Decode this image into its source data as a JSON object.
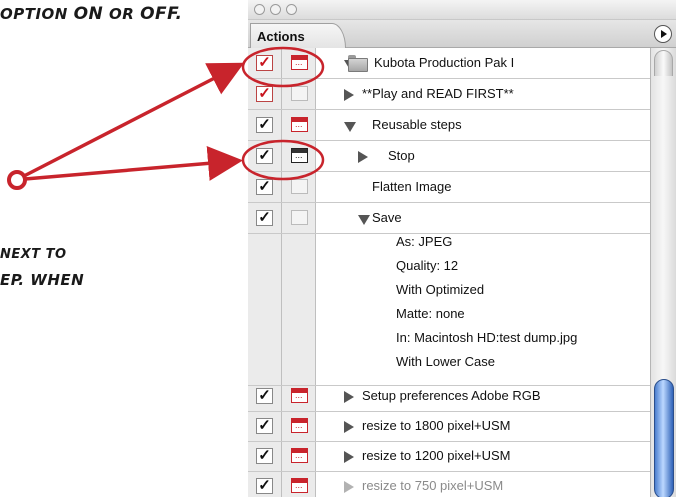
{
  "annotation": {
    "top_text_start": "OPTION",
    "top_on": "ON",
    "top_or": "OR",
    "top_off": "OFF.",
    "side_line1": "NEXT TO",
    "side_line2": "EP. WHEN"
  },
  "colors": {
    "annotation_red": "#c8242c",
    "scroll_thumb": "#4c7fcf"
  },
  "panel": {
    "tab_label": "Actions",
    "menu_icon": "panel-menu-icon"
  },
  "rows": [
    {
      "label": "Kubota Production Pak I",
      "toggle": "red",
      "dialog": "red",
      "expand": "down",
      "indent": 0,
      "folder": true
    },
    {
      "label": "**Play and READ FIRST**",
      "toggle": "red",
      "dialog": "empty",
      "expand": "right",
      "indent": 1
    },
    {
      "label": "Reusable steps",
      "toggle": "black",
      "dialog": "red",
      "expand": "down",
      "indent": 1
    },
    {
      "label": "Stop",
      "toggle": "black",
      "dialog": "black",
      "expand": "right",
      "indent": 2
    },
    {
      "label": "Flatten Image",
      "toggle": "black",
      "dialog": "empty",
      "expand": "none",
      "indent": 2
    },
    {
      "label": "Save",
      "toggle": "black",
      "dialog": "empty",
      "expand": "down",
      "indent": 2
    }
  ],
  "save_details": [
    "As: JPEG",
    "Quality: 12",
    "With Optimized",
    "Matte: none",
    "In: Macintosh HD:test dump.jpg",
    "With Lower Case"
  ],
  "rows_after": [
    {
      "label": "Setup preferences Adobe RGB",
      "toggle": "black",
      "dialog": "red",
      "expand": "right",
      "faded": false
    },
    {
      "label": "resize to 1800 pixel+USM",
      "toggle": "black",
      "dialog": "red",
      "expand": "right",
      "faded": false
    },
    {
      "label": "resize to 1200 pixel+USM",
      "toggle": "black",
      "dialog": "red",
      "expand": "right",
      "faded": false
    },
    {
      "label": "resize to 750 pixel+USM",
      "toggle": "black",
      "dialog": "red",
      "expand": "right",
      "faded": true
    }
  ]
}
